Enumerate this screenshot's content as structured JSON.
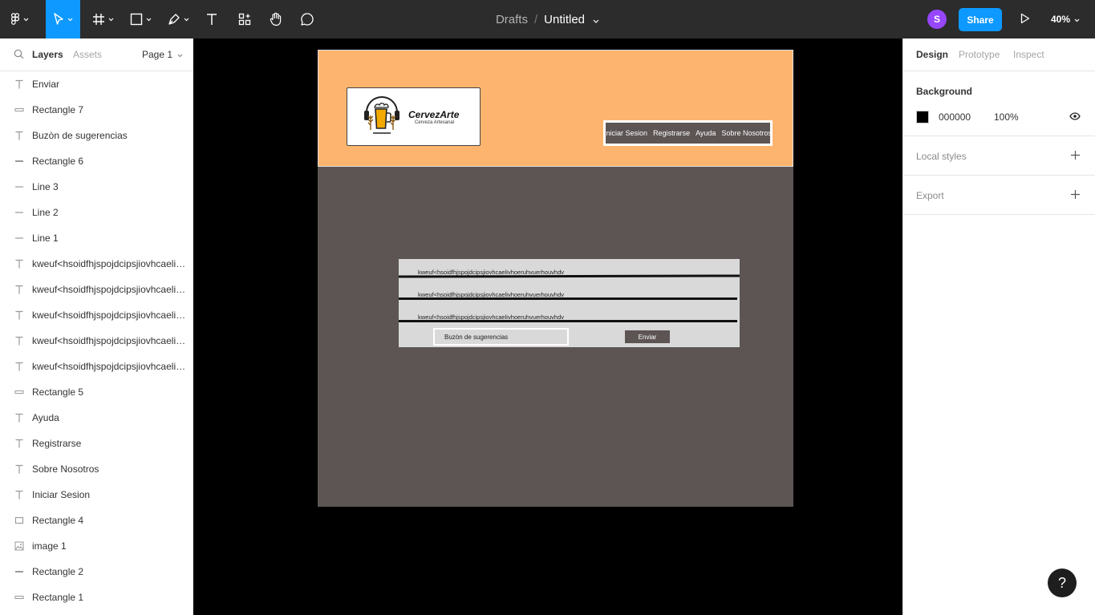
{
  "toolbar": {
    "tools": [
      "main-menu",
      "move",
      "frame",
      "shape",
      "pen",
      "text",
      "resources",
      "hand",
      "comment"
    ],
    "breadcrumb_root": "Drafts",
    "separator": "/",
    "file_name": "Untitled",
    "avatar_initial": "S",
    "share_label": "Share",
    "zoom": "40%"
  },
  "left_panel": {
    "tab_layers": "Layers",
    "tab_assets": "Assets",
    "page": "Page 1",
    "layers": [
      {
        "label": "Enviar",
        "icon": "text"
      },
      {
        "label": "Rectangle 7",
        "icon": "rect-thin"
      },
      {
        "label": "Buzòn de sugerencias",
        "icon": "text"
      },
      {
        "label": "Rectangle 6",
        "icon": "rect-bar"
      },
      {
        "label": "Line 3",
        "icon": "line"
      },
      {
        "label": "Line 2",
        "icon": "line"
      },
      {
        "label": "Line 1",
        "icon": "line"
      },
      {
        "label": "kweuf<hsoidfhjspojdcipsjiovhcaelivhoeruhvuerhouvhdv",
        "icon": "text"
      },
      {
        "label": "kweuf<hsoidfhjspojdcipsjiovhcaelivhoeruhvuerhouvhdv",
        "icon": "text"
      },
      {
        "label": "kweuf<hsoidfhjspojdcipsjiovhcaelivhoeruhvuerhouvhdv",
        "icon": "text"
      },
      {
        "label": "kweuf<hsoidfhjspojdcipsjiovhcaelivhoeruhvuerhouvhdv",
        "icon": "text"
      },
      {
        "label": "kweuf<hsoidfhjspojdcipsjiovhcaelivhoeruhvuerhouvhdv",
        "icon": "text"
      },
      {
        "label": "Rectangle 5",
        "icon": "rect-thin"
      },
      {
        "label": "Ayuda",
        "icon": "text"
      },
      {
        "label": "Registrarse",
        "icon": "text"
      },
      {
        "label": "Sobre Nosotros",
        "icon": "text"
      },
      {
        "label": "Iniciar Sesion",
        "icon": "text"
      },
      {
        "label": "Rectangle 4",
        "icon": "rect"
      },
      {
        "label": "image 1",
        "icon": "image"
      },
      {
        "label": "Rectangle 2",
        "icon": "rect-bar"
      },
      {
        "label": "Rectangle 1",
        "icon": "rect-thin"
      }
    ]
  },
  "canvas": {
    "logo_name": "CervezArte",
    "logo_tagline": "Cerveza Artesanal",
    "nav": [
      "Iniciar Sesion",
      "Registrarse",
      "Ayuda",
      "Sobre Nosotros"
    ],
    "rows": [
      "kweuf<hsoidfhjspojdcipsjiovhcaelivhoeruhvuerhouvhdv",
      "kweuf<hsoidfhjspojdcipsjiovhcaelivhoeruhvuerhouvhdv",
      "kweuf<hsoidfhjspojdcipsjiovhcaelivhoeruhvuerhouvhdv"
    ],
    "suggestion_label": "Buzòn de sugerencias",
    "send_label": "Enviar",
    "colors": {
      "header": "#fdb46e",
      "body": "#5d5454",
      "panel": "#d9d9d9"
    }
  },
  "right_panel": {
    "tab_design": "Design",
    "tab_prototype": "Prototype",
    "tab_inspect": "Inspect",
    "background_title": "Background",
    "background_hex": "000000",
    "background_opacity": "100%",
    "local_styles": "Local styles",
    "export": "Export"
  },
  "help": "?"
}
